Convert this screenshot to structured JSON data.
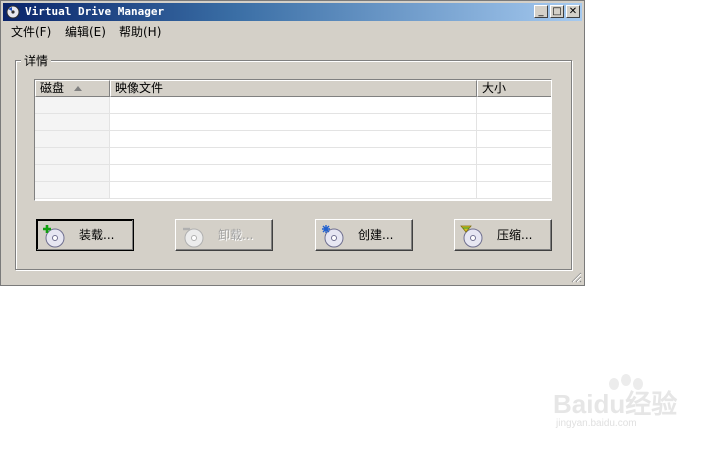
{
  "window": {
    "title": "Virtual Drive Manager",
    "controls": {
      "minimize": "_",
      "maximize": "□",
      "close": "✕"
    }
  },
  "menu": [
    {
      "label": "文件(F)"
    },
    {
      "label": "编辑(E)"
    },
    {
      "label": "帮助(H)"
    }
  ],
  "details": {
    "group_label": "详情",
    "columns": [
      {
        "label": "磁盘",
        "sorted": "ascending"
      },
      {
        "label": "映像文件"
      },
      {
        "label": "大小"
      }
    ],
    "rows": [
      {},
      {},
      {},
      {},
      {},
      {}
    ]
  },
  "buttons": [
    {
      "label": "装载...",
      "icon": "disc-add-icon",
      "enabled": true
    },
    {
      "label": "卸载...",
      "icon": "disc-eject-icon",
      "enabled": false
    },
    {
      "label": "创建...",
      "icon": "disc-create-icon",
      "enabled": true
    },
    {
      "label": "压缩...",
      "icon": "disc-compress-icon",
      "enabled": true
    }
  ],
  "watermark": {
    "brand": "Baidu经验",
    "site": "jingyan.baidu.com"
  }
}
